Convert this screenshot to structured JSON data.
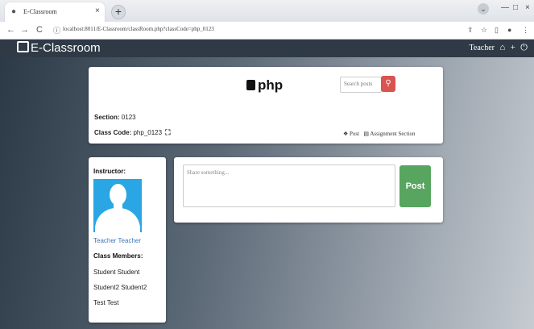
{
  "browser": {
    "tab_title": "E-Classroom",
    "tab_close": "×",
    "new_tab": "+",
    "url": "localhost:8011/E-Classroom/classRoom.php?classCode=php_0123",
    "nav_back": "←",
    "nav_forward": "→",
    "nav_reload": "C",
    "info_icon": "ⓘ",
    "win_min": "—",
    "win_max": "□",
    "win_close": "×",
    "win_dropdown": "⌄"
  },
  "app": {
    "brand": "E-Classroom",
    "user_label": "Teacher",
    "home_glyph": "⌂",
    "add_glyph": "+",
    "power_glyph": "⏻"
  },
  "header": {
    "class_title": "php",
    "search_placeholder": "Search posts",
    "search_glyph": "🔍",
    "section_label": "Section:",
    "section_value": "0123",
    "classcode_label": "Class Code:",
    "classcode_value": "php_0123",
    "expand_glyph": "⛶",
    "post_link": "Post",
    "assignment_link": "Assignment Section"
  },
  "sidebar": {
    "instructor_label": "Instructor:",
    "instructor_name": "Teacher Teacher",
    "members_label": "Class Members:",
    "members": [
      "Student Student",
      "Student2 Student2",
      "Test Test"
    ]
  },
  "composer": {
    "placeholder": "Share something...",
    "post_button": "Post"
  },
  "colors": {
    "navbar": "#2f3a46",
    "search_button": "#d9534f",
    "post_button": "#57a55f",
    "avatar_bg": "#29a6e3",
    "link": "#3f79b8"
  }
}
